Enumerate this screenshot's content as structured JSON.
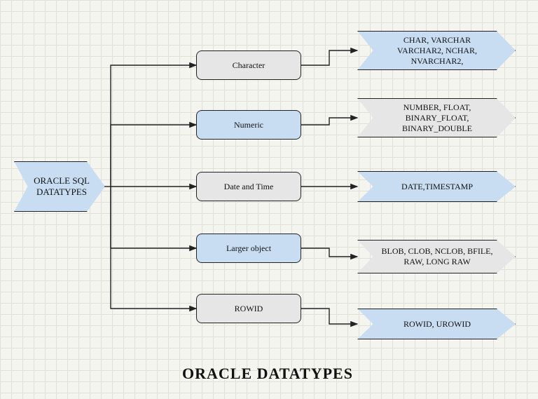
{
  "root": {
    "label": "ORACLE SQL\nDATATYPES"
  },
  "categories": [
    {
      "label": "Character",
      "leaf": "CHAR, VARCHAR\nVARCHAR2, NCHAR,\nNVARCHAR2,"
    },
    {
      "label": "Numeric",
      "leaf": "NUMBER, FLOAT,\nBINARY_FLOAT,\nBINARY_DOUBLE"
    },
    {
      "label": "Date and Time",
      "leaf": "DATE,TIMESTAMP"
    },
    {
      "label": "Larger object",
      "leaf": "BLOB, CLOB, NCLOB, BFILE,\nRAW, LONG RAW"
    },
    {
      "label": "ROWID",
      "leaf": "ROWID, UROWID"
    }
  ],
  "title": "ORACLE DATATYPES"
}
